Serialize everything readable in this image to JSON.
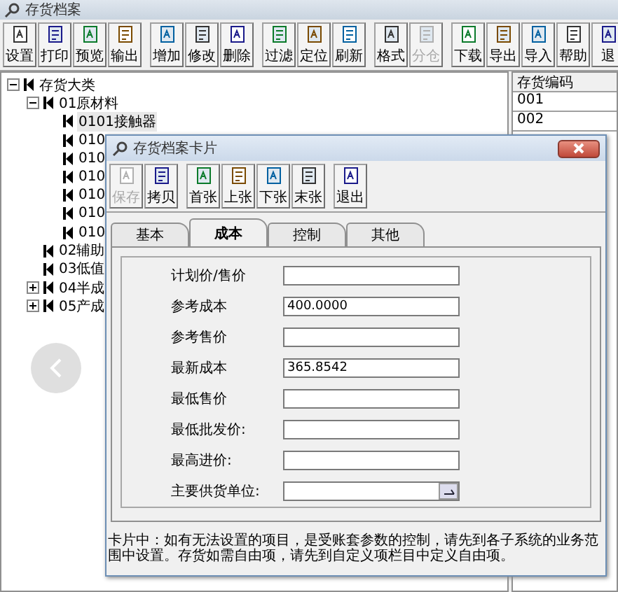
{
  "window": {
    "title": "存货档案"
  },
  "toolbar": [
    [
      {
        "label": "设置",
        "disabled": false
      },
      {
        "label": "打印",
        "disabled": false
      },
      {
        "label": "预览",
        "disabled": false
      },
      {
        "label": "输出",
        "disabled": false
      }
    ],
    [
      {
        "label": "增加",
        "disabled": false
      },
      {
        "label": "修改",
        "disabled": false
      },
      {
        "label": "删除",
        "disabled": false
      }
    ],
    [
      {
        "label": "过滤",
        "disabled": false
      },
      {
        "label": "定位",
        "disabled": false
      },
      {
        "label": "刷新",
        "disabled": false
      }
    ],
    [
      {
        "label": "格式",
        "disabled": false
      },
      {
        "label": "分仓",
        "disabled": true
      }
    ],
    [
      {
        "label": "下载",
        "disabled": false
      },
      {
        "label": "导出",
        "disabled": false
      },
      {
        "label": "导入",
        "disabled": false
      },
      {
        "label": "帮助",
        "disabled": false
      },
      {
        "label": "退",
        "disabled": false
      }
    ]
  ],
  "tree": [
    {
      "label": "存货大类",
      "expanded": true,
      "children": [
        {
          "label": "01原材料",
          "expanded": true,
          "children": [
            {
              "label": "0101接触器",
              "selected": true
            },
            {
              "label": "010",
              "selected": false
            },
            {
              "label": "010",
              "selected": false
            },
            {
              "label": "010",
              "selected": false
            },
            {
              "label": "010",
              "selected": false
            },
            {
              "label": "010",
              "selected": false
            },
            {
              "label": "010",
              "selected": false
            }
          ]
        },
        {
          "label": "02辅助"
        },
        {
          "label": "03低值"
        },
        {
          "label": "04半成",
          "expanded": false
        },
        {
          "label": "05产成",
          "expanded": false
        }
      ]
    }
  ],
  "table": {
    "columns": [
      "存货编码"
    ],
    "rows": [
      "001",
      "002"
    ]
  },
  "dialog": {
    "title": "存货档案卡片",
    "toolbar": [
      [
        {
          "label": "保存",
          "disabled": true
        },
        {
          "label": "拷贝",
          "disabled": false
        }
      ],
      [
        {
          "label": "首张",
          "disabled": false
        },
        {
          "label": "上张",
          "disabled": false
        },
        {
          "label": "下张",
          "disabled": false
        },
        {
          "label": "末张",
          "disabled": false
        }
      ],
      [
        {
          "label": "退出",
          "disabled": false
        }
      ]
    ],
    "tabs": [
      {
        "label": "基本",
        "selected": false
      },
      {
        "label": "成本",
        "selected": true
      },
      {
        "label": "控制",
        "selected": false
      },
      {
        "label": "其他",
        "selected": false
      }
    ],
    "fields": [
      {
        "label": "计划价/售价",
        "kind": "text"
      },
      {
        "label": "参考成本",
        "value": "400.0000",
        "kind": "text"
      },
      {
        "label": "参考售价",
        "kind": "text"
      },
      {
        "label": "最新成本",
        "value": "365.8542",
        "kind": "text"
      },
      {
        "label": "最低售价",
        "kind": "text"
      },
      {
        "label": "最低批发价:",
        "kind": "text"
      },
      {
        "label": "最高进价:",
        "kind": "text"
      },
      {
        "label": "主要供货单位:",
        "kind": "lookup"
      }
    ],
    "note": "卡片中：如有无法设置的项目，是受账套参数的控制，请先到各子系统的业务范围中设置。存货如需自由项，请先到自定义项栏目中定义自由项。"
  }
}
